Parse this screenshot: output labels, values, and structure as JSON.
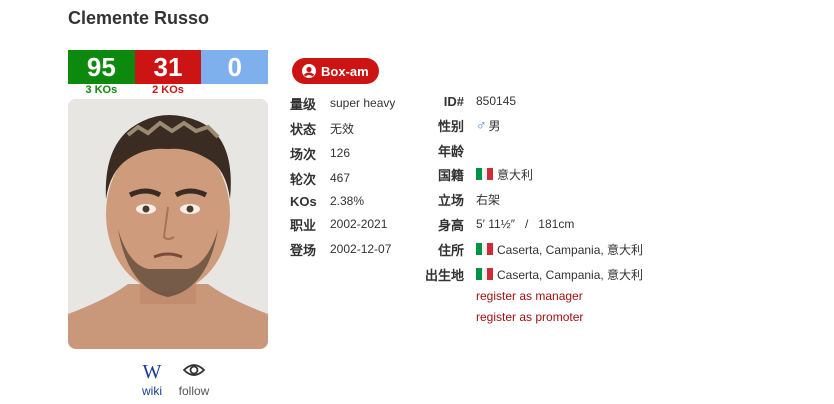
{
  "boxer_name": "Clemente Russo",
  "record": {
    "wins": "95",
    "losses": "31",
    "draws": "0",
    "win_kos": "3 KOs",
    "loss_kos": "2 KOs"
  },
  "badge": {
    "label": "Box-am",
    "icon": "user-circle-icon"
  },
  "left_details": [
    {
      "label": "量级",
      "value": "super heavy"
    },
    {
      "label": "状态",
      "value": "无效"
    },
    {
      "label": "场次",
      "value": "126"
    },
    {
      "label": "轮次",
      "value": "467"
    },
    {
      "label": "KOs",
      "value": "2.38%"
    },
    {
      "label": "职业",
      "value": "2002-2021"
    },
    {
      "label": "登场",
      "value": "2002-12-07"
    }
  ],
  "right_details": [
    {
      "label": "ID#",
      "value": "850145"
    },
    {
      "label": "性别",
      "value": "男",
      "icon": "male-icon"
    },
    {
      "label": "年龄",
      "value": ""
    },
    {
      "label": "国籍",
      "value": "意大利",
      "flag": "italy-flag"
    },
    {
      "label": "立场",
      "value": "右架"
    },
    {
      "label": "身高",
      "value": "5′ 11½″   /   181cm"
    },
    {
      "label": "住所",
      "value": "Caserta, Campania, 意大利",
      "flag": "italy-flag"
    },
    {
      "label": "出生地",
      "value": "Caserta, Campania, 意大利",
      "flag": "italy-flag"
    }
  ],
  "links": {
    "manager": "register as manager",
    "promoter": "register as promoter"
  },
  "footer": {
    "wiki_label": "wiki",
    "wiki_glyph": "W",
    "follow_label": "follow"
  },
  "colors": {
    "win": "#0d8a0d",
    "loss": "#cc1414",
    "draw": "#7fb0ee",
    "badge": "#cc1414",
    "link": "#a01010"
  }
}
